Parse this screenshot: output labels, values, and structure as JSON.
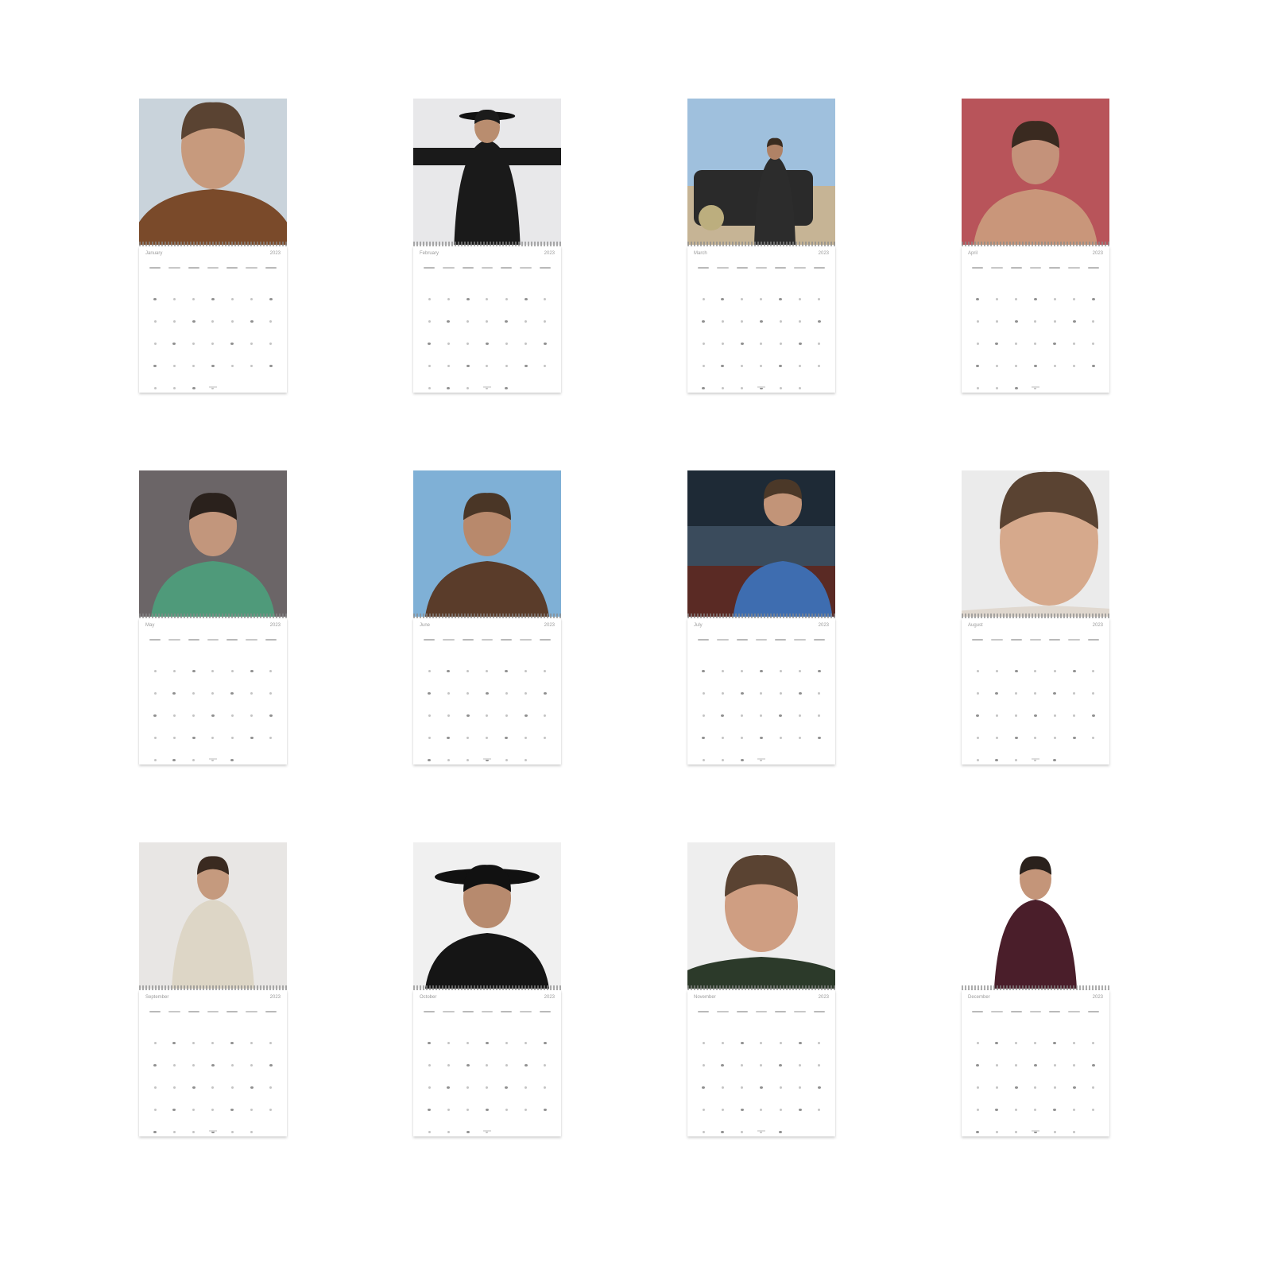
{
  "calendar_year": "2023",
  "months": [
    {
      "name": "January",
      "photo": {
        "bg": "#c9d3db",
        "clothing": "#7a4a2a",
        "skin": "#c79a7d",
        "hair": "#5a4332",
        "pose": "close"
      }
    },
    {
      "name": "February",
      "photo": {
        "bg": "#e8e8ea",
        "clothing": "#1a1a1a",
        "skin": "#b98d6f",
        "hair": "#1b1b1b",
        "pose": "arms-out"
      }
    },
    {
      "name": "March",
      "photo": {
        "bg": "#9fc0dd",
        "clothing": "#2c2c2c",
        "skin": "#b08266",
        "hair": "#3a2c20",
        "pose": "car"
      }
    },
    {
      "name": "April",
      "photo": {
        "bg": "#b8545a",
        "clothing": "#c9967a",
        "skin": "#c4927a",
        "hair": "#3a2a20",
        "pose": "shirtless"
      }
    },
    {
      "name": "May",
      "photo": {
        "bg": "#6b6567",
        "clothing": "#4f9a7a",
        "skin": "#c2967c",
        "hair": "#2a211c",
        "pose": "mid"
      }
    },
    {
      "name": "June",
      "photo": {
        "bg": "#7fb0d6",
        "clothing": "#5a3c2a",
        "skin": "#b8896c",
        "hair": "#4a3626",
        "pose": "hat-hand"
      }
    },
    {
      "name": "July",
      "photo": {
        "bg": "#3a4b5c",
        "clothing": "#3e6db0",
        "skin": "#c29478",
        "hair": "#4b3828",
        "pose": "car-interior"
      }
    },
    {
      "name": "August",
      "photo": {
        "bg": "#ebebeb",
        "clothing": "#e0d8cf",
        "skin": "#d6a98c",
        "hair": "#5a4332",
        "pose": "face"
      }
    },
    {
      "name": "September",
      "photo": {
        "bg": "#e8e6e4",
        "clothing": "#ddd6c6",
        "skin": "#c59a7e",
        "hair": "#3a2a20",
        "pose": "arms-crossed"
      }
    },
    {
      "name": "October",
      "photo": {
        "bg": "#f0f0f0",
        "clothing": "#151515",
        "skin": "#b78a6e",
        "hair": "#111111",
        "pose": "cowboy-hat"
      }
    },
    {
      "name": "November",
      "photo": {
        "bg": "#eeeeee",
        "clothing": "#2c3a2a",
        "skin": "#cf9e82",
        "hair": "#5a4332",
        "pose": "smile"
      }
    },
    {
      "name": "December",
      "photo": {
        "bg": "#ffffff",
        "clothing": "#4a1e2a",
        "skin": "#c49579",
        "hair": "#2a211c",
        "pose": "suit"
      }
    }
  ]
}
